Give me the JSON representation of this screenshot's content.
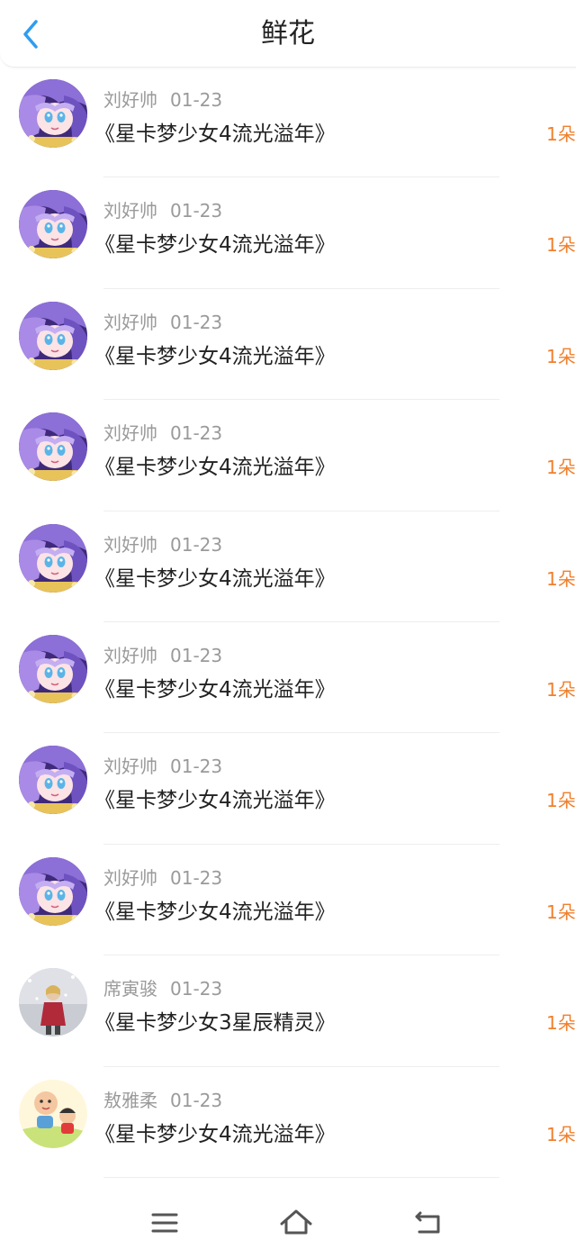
{
  "header": {
    "title": "鲜花",
    "back_icon": "chevron-left-icon",
    "accent_color": "#2f9cf0"
  },
  "list": {
    "items": [
      {
        "user": "刘好帅",
        "date": "01-23",
        "book": "《星卡梦少女4流光溢年》",
        "count": "1朵",
        "avatar": "anime-girl"
      },
      {
        "user": "刘好帅",
        "date": "01-23",
        "book": "《星卡梦少女4流光溢年》",
        "count": "1朵",
        "avatar": "anime-girl"
      },
      {
        "user": "刘好帅",
        "date": "01-23",
        "book": "《星卡梦少女4流光溢年》",
        "count": "1朵",
        "avatar": "anime-girl"
      },
      {
        "user": "刘好帅",
        "date": "01-23",
        "book": "《星卡梦少女4流光溢年》",
        "count": "1朵",
        "avatar": "anime-girl"
      },
      {
        "user": "刘好帅",
        "date": "01-23",
        "book": "《星卡梦少女4流光溢年》",
        "count": "1朵",
        "avatar": "anime-girl"
      },
      {
        "user": "刘好帅",
        "date": "01-23",
        "book": "《星卡梦少女4流光溢年》",
        "count": "1朵",
        "avatar": "anime-girl"
      },
      {
        "user": "刘好帅",
        "date": "01-23",
        "book": "《星卡梦少女4流光溢年》",
        "count": "1朵",
        "avatar": "anime-girl"
      },
      {
        "user": "刘好帅",
        "date": "01-23",
        "book": "《星卡梦少女4流光溢年》",
        "count": "1朵",
        "avatar": "anime-girl"
      },
      {
        "user": "席寅骏",
        "date": "01-23",
        "book": "《星卡梦少女3星辰精灵》",
        "count": "1朵",
        "avatar": "winter-photo"
      },
      {
        "user": "敖雅柔",
        "date": "01-23",
        "book": "《星卡梦少女4流光溢年》",
        "count": "1朵",
        "avatar": "cartoon-kids"
      }
    ]
  },
  "colors": {
    "count": "#f07f2c",
    "meta": "#9a9a9a",
    "text": "#222222"
  },
  "navbar": {
    "icons": [
      "menu-icon",
      "home-icon",
      "back-icon"
    ]
  }
}
